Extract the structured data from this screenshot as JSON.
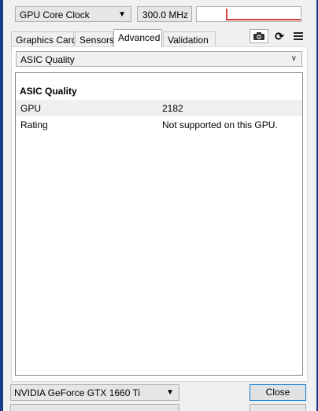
{
  "sensor": {
    "name": "GPU Core Clock",
    "value": "300.0 MHz",
    "graph_color": "#c00000"
  },
  "tabs": [
    {
      "label": "Graphics Card",
      "active": false
    },
    {
      "label": "Sensors",
      "active": false
    },
    {
      "label": "Advanced",
      "active": true
    },
    {
      "label": "Validation",
      "active": false
    }
  ],
  "toolbar": {
    "camera_icon": "camera-icon",
    "refresh_icon": "refresh-icon",
    "menu_icon": "hamburger-menu-icon"
  },
  "advanced": {
    "section_select": "ASIC Quality",
    "heading": "ASIC Quality",
    "rows": [
      {
        "key": "GPU",
        "value": "2182"
      },
      {
        "key": "Rating",
        "value": "Not supported on this GPU."
      }
    ]
  },
  "footer": {
    "gpu_select": "NVIDIA GeForce GTX 1660 Ti",
    "close_label": "Close",
    "accent": "#0078d7"
  }
}
